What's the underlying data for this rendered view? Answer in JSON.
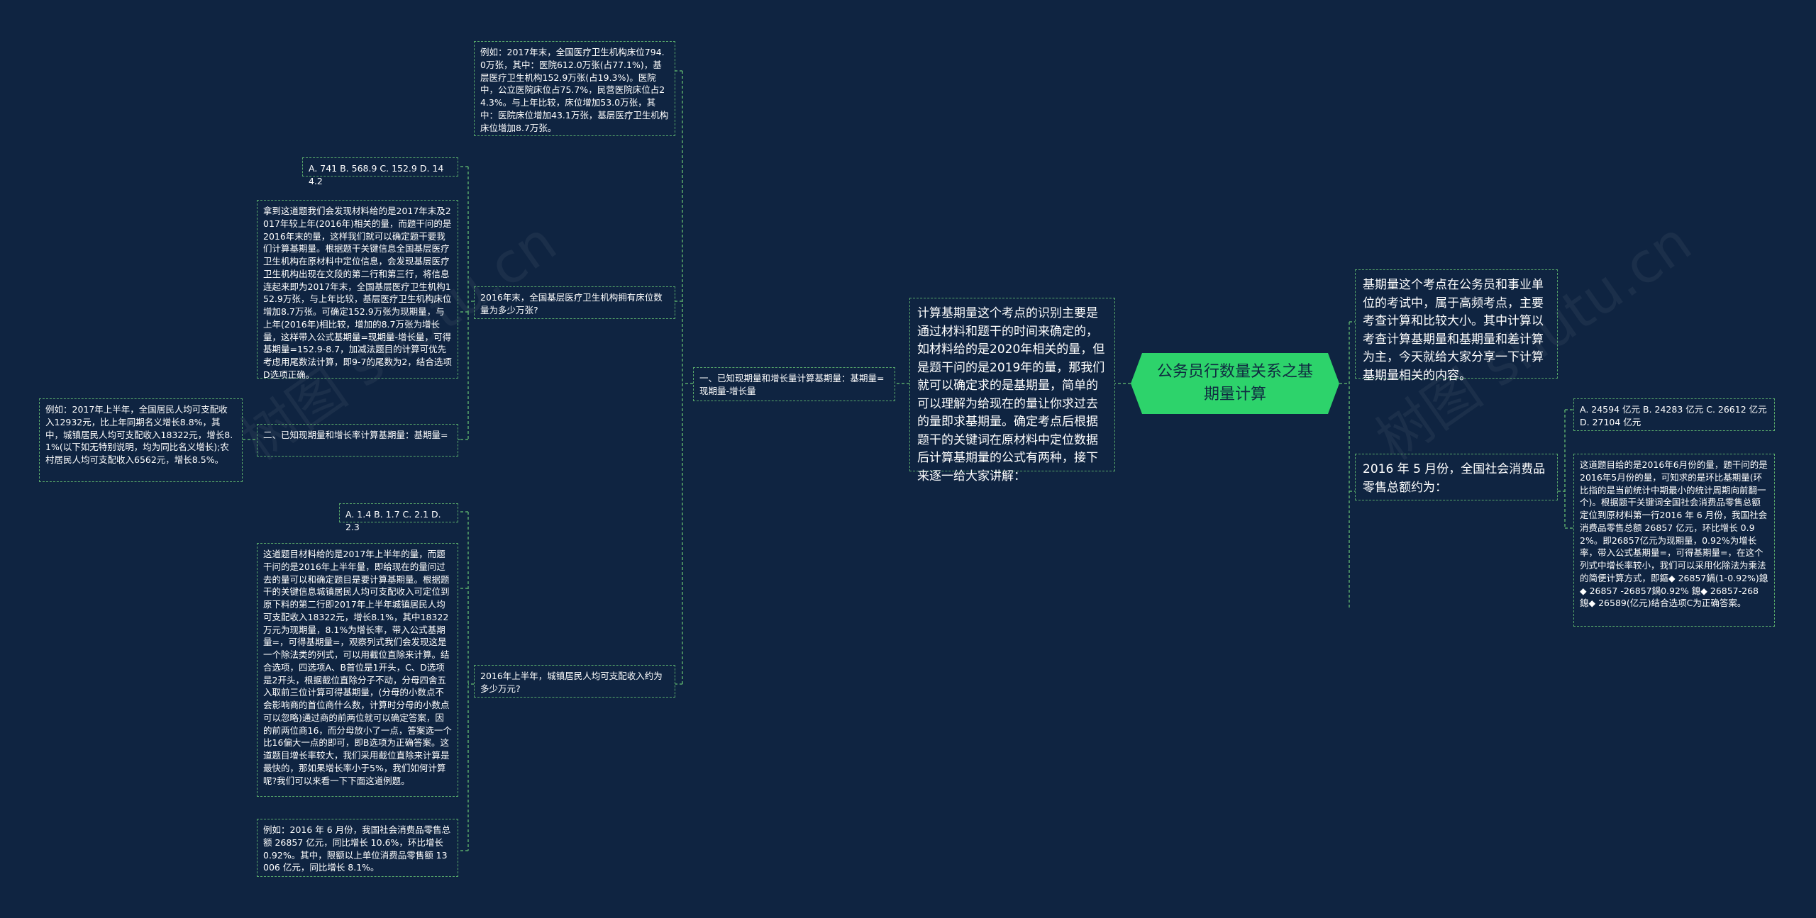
{
  "root": {
    "title": "公务员行数量关系之基期量计算"
  },
  "intro": "计算基期量这个考点的识别主要是通过材料和题干的时间来确定的，如材料给的是2020年相关的量，但是题干问的是2019年的量，那我们就可以确定求的是基期量，简单的可以理解为给现在的量让你求过去的量即求基期量。确定考点后根据题干的关键词在原材料中定位数据后计算基期量的公式有两种，接下来逐一给大家讲解：",
  "branch1": {
    "label": "一、已知现期量和增长量计算基期量：基期量=现期量-增长量",
    "example": "例如：2017年末，全国医疗卫生机构床位794.0万张，其中：医院612.0万张(占77.1%)，基层医疗卫生机构152.9万张(占19.3%)。医院中，公立医院床位占75.7%，民营医院床位占24.3%。与上年比较，床位增加53.0万张，其中：医院床位增加43.1万张，基层医疗卫生机构床位增加8.7万张。",
    "question": "2016年末，全国基层医疗卫生机构拥有床位数量为多少万张?",
    "options": "A. 741 B. 568.9 C. 152.9 D. 144.2",
    "analysis": "拿到这道题我们会发现材料给的是2017年末及2017年较上年(2016年)相关的量，而题干问的是2016年末的量，这样我们就可以确定题干要我们计算基期量。根据题干关键信息全国基层医疗卫生机构在原材料中定位信息，会发现基层医疗卫生机构出现在文段的第二行和第三行，将信息连起来即为2017年末，全国基层医疗卫生机构152.9万张，与上年比较，基层医疗卫生机构床位增加8.7万张。可确定152.9万张为现期量，与上年(2016年)相比较，增加的8.7万张为增长量，这样带入公式基期量=现期量-增长量，可得基期量=152.9-8.7，加减法题目的计算可优先考虑用尾数法计算，即9-7的尾数为2，结合选项D选项正确。"
  },
  "branch2": {
    "label": "二、已知现期量和增长率计算基期量：基期量=",
    "example": "例如：2017年上半年，全国居民人均可支配收入12932元，比上年同期名义增长8.8%，其中，城镇居民人均可支配收入18322元，增长8.1%(以下如无特别说明，均为同比名义增长);农村居民人均可支配收入6562元，增长8.5%。",
    "question": "2016年上半年，城镇居民人均可支配收入约为多少万元?",
    "options": "A. 1.4 B. 1.7 C. 2.1 D. 2.3",
    "analysis": "这道题目材料给的是2017年上半年的量，而题干问的是2016年上半年量，即给现在的量问过去的量可以和确定题目是要计算基期量。根据题干的关键信息城镇居民人均可支配收入可定位到原下料的第二行即2017年上半年城镇居民人均可支配收入18322元，增长8.1%，其中18322万元为现期量，8.1%为增长率，带入公式基期量=，可得基期量=，观察列式我们会发现这是一个除法类的列式，可以用截位直除来计算。结合选项，四选项A、B首位是1开头，C、D选项是2开头，根据截位直除分子不动，分母四舍五入取前三位计算可得基期量，(分母的小数点不会影响商的首位商什么数，计算时分母的小数点可以忽略)通过商的前两位就可以确定答案，因的前两位商16，而分母放小了一点，答案选一个比16偏大一点的即可，即B选项为正确答案。这道题目增长率较大，我们采用截位直除来计算是最快的，那如果增长率小于5%，我们如何计算呢?我们可以来看一下下面这道例题。",
    "example2": "例如：2016 年 6 月份，我国社会消费品零售总额 26857 亿元，同比增长 10.6%，环比增长 0.92%。其中，限额以上单位消费品零售额 13006 亿元，同比增长 8.1%。"
  },
  "right": {
    "summary": "基期量这个考点在公务员和事业单位的考试中，属于高频考点，主要考查计算和比较大小。其中计算以考查计算基期量和基期量和差计算为主，今天就给大家分享一下计算基期量相关的内容。",
    "question": "2016 年 5 月份，全国社会消费品零售总额约为：",
    "options": "A. 24594 亿元 B. 24283 亿元 C. 26612 亿元 D. 27104 亿元",
    "analysis": "这道题目给的是2016年6月份的量，题干问的是2016年5月份的量，可知求的是环比基期量(环比指的是当前统计中期最小的统计周期向前翻一个)。根据题干关键词全国社会消费品零售总额定位到原材料第一行2016 年 6 月份，我国社会消费品零售总额 26857 亿元，环比增长 0.92%。即26857亿元为现期量，0.92%为增长率，带入公式基期量=，可得基期量=，在这个列式中增长率较小，我们可以采用化除法为乘法的简便计算方式，即鏂◆ 26857鍋(1-0.92%)鎴◆ 26857 -26857鍋0.92% 鎴◆ 26857-268 鎴◆ 26589(亿元)结合选项C为正确答案。"
  },
  "watermarks": [
    "树图 shutu.cn",
    "树图 shutu.cn"
  ],
  "colors": {
    "background": "#0f2441",
    "accent": "#2dd36b",
    "connector": "#58a86a"
  }
}
